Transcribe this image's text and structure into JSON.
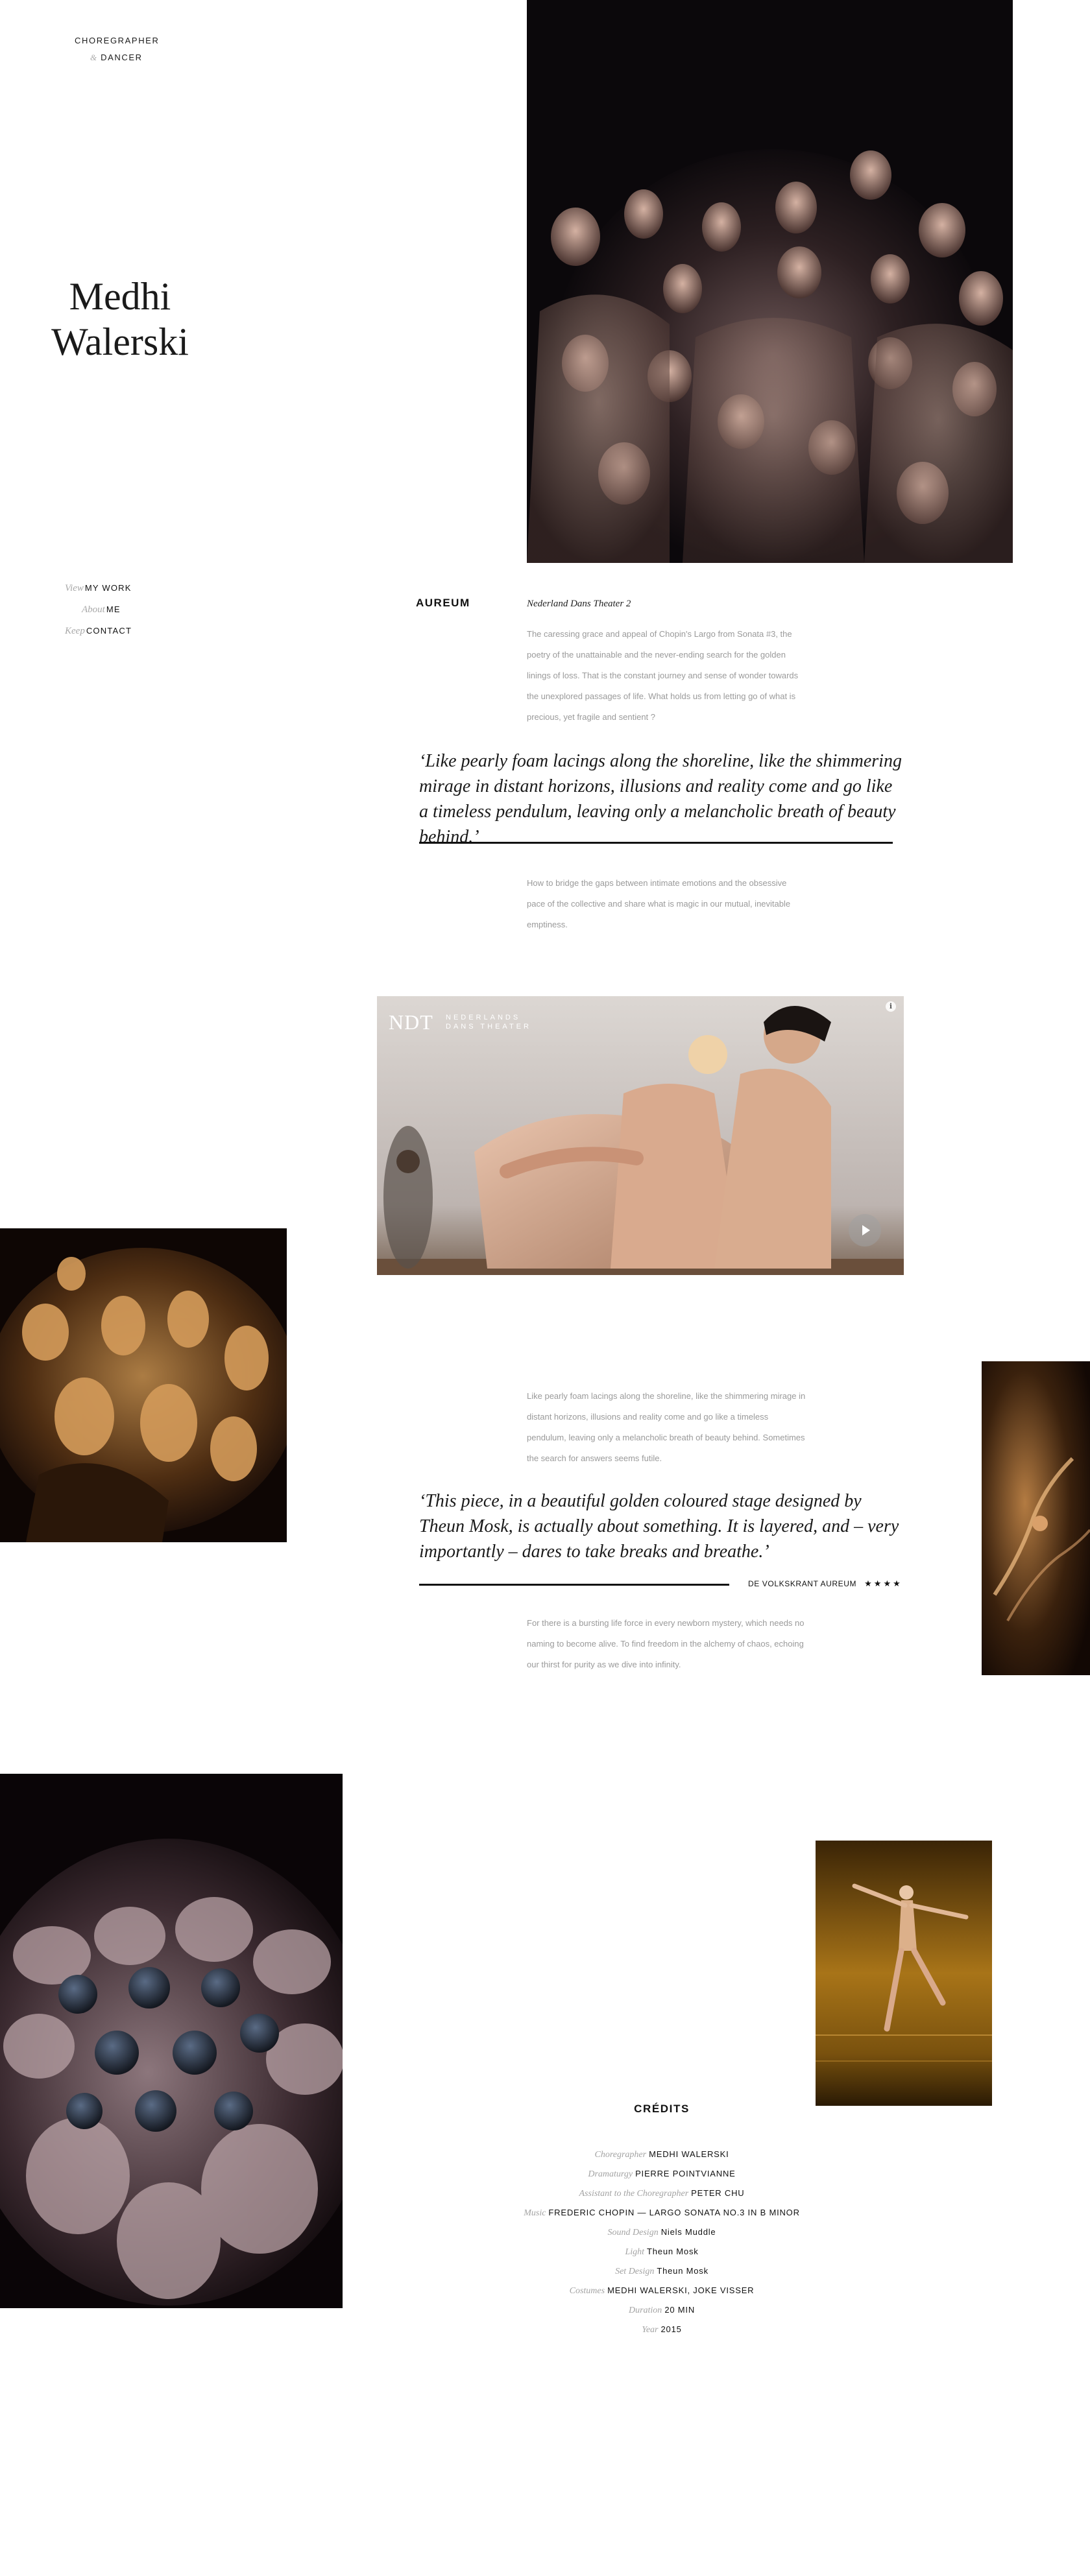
{
  "header": {
    "brand_line1": "Choregrapher",
    "brand_amp": "&",
    "brand_line2": "Dancer",
    "name_first": "Medhi",
    "name_last": "Walerski"
  },
  "nav": {
    "items": [
      {
        "prefix": "View",
        "label": "MY WORK"
      },
      {
        "prefix": "About",
        "label": "ME"
      },
      {
        "prefix": "Keep",
        "label": "CONTACT"
      }
    ]
  },
  "work": {
    "title": "AUREUM",
    "company": "Nederland Dans Theater 2",
    "intro": "The caressing grace and appeal of Chopin's Largo from Sonata #3, the poetry of the unattainable and the never-ending search for the golden linings of loss. That is the constant journey and sense of wonder towards the unexplored passages of life. What holds us from letting go of what is precious, yet fragile and sentient ?",
    "quote1": "‘Like pearly foam lacings along the shoreline, like the shimmering mirage in distant horizons, illusions and reality come and go like a timeless pendulum, leaving only a melancholic breath of beauty behind.’",
    "para2": "How to bridge the gaps between intimate emotions and the obsessive pace of the collective and share what is magic in our mutual, inevitable emptiness.",
    "video": {
      "logo": "NDT",
      "sub_line1": "NEDERLANDS",
      "sub_line2": "DANS THEATER",
      "info_icon": "i"
    },
    "para3": "Like pearly foam lacings along the shoreline, like the shimmering mirage in distant horizons, illusions and reality come and go like a timeless pendulum, leaving only a melancholic breath of beauty behind. Sometimes the search for answers seems futile.",
    "quote2": "‘This piece, in a beautiful golden coloured stage designed by Theun Mosk, is actually about something. It is layered, and  – very importantly – dares to take breaks and breathe.’",
    "review_source": "DE VOLKSKRANT AUREUM",
    "review_stars": "★★★★",
    "para4": "For there is a bursting life force in every newborn mystery, which needs no naming to become alive. To find freedom in the alchemy of chaos, echoing our thirst for purity as we dive into infinity."
  },
  "credits": {
    "title": "CRÉDITS",
    "rows": [
      {
        "role": "Choregrapher",
        "value": "MEDHI WALERSKI"
      },
      {
        "role": "Dramaturgy",
        "value": "PIERRE POINTVIANNE"
      },
      {
        "role": "Assistant to the Choregrapher",
        "value": "PETER CHU"
      },
      {
        "role": "Music",
        "value": "FREDERIC CHOPIN — LARGO SONATA NO.3 IN B MINOR"
      },
      {
        "role": "Sound Design",
        "value": "Niels Muddle"
      },
      {
        "role": "Light",
        "value": "Theun Mosk"
      },
      {
        "role": "Set Design",
        "value": "Theun Mosk"
      },
      {
        "role": "Costumes",
        "value": "MEDHI WALERSKI, JOKE VISSER"
      },
      {
        "role": "Duration",
        "value": "20 MIN"
      },
      {
        "role": "Year",
        "value": "2015"
      }
    ]
  },
  "colors": {
    "text": "#1a1a1a",
    "muted": "#9a9a9a",
    "italic_label": "#a8a8a8",
    "photo_dark": "#0b080b",
    "gold": "#b07a35"
  }
}
